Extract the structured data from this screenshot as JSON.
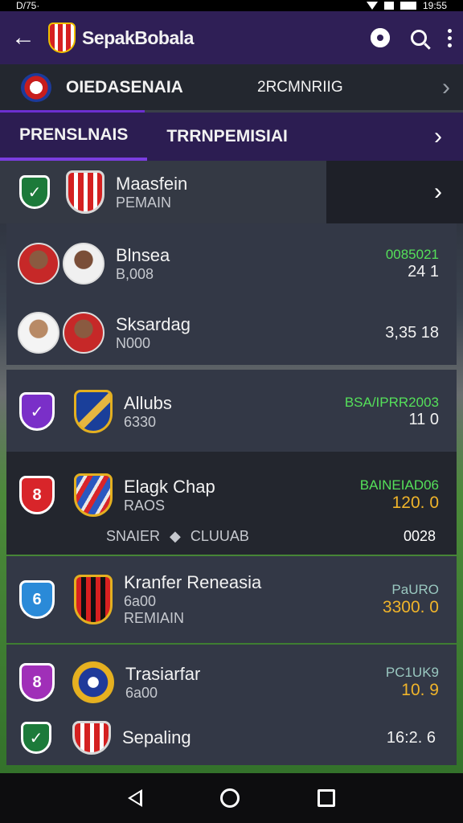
{
  "statusbar": {
    "left": "D/75·",
    "time": "19:55"
  },
  "appbar": {
    "title": "SepakBobala"
  },
  "league": {
    "label_left": "OIEDASENAIA",
    "label_right": "2RCMNRIIG"
  },
  "tabs": [
    {
      "label": "PRENSLNAIS"
    },
    {
      "label": "TRRNPEMISIAI"
    }
  ],
  "featured": {
    "name": "Maasfein",
    "sub": "PEMAIN"
  },
  "players_card": {
    "rows": [
      {
        "name": "Blnsea",
        "sub": "B,008",
        "stat_top": "0085021",
        "stat_main": "24  1"
      },
      {
        "name": "Sksardag",
        "sub": "N000",
        "stat_main": "3,35  18"
      }
    ]
  },
  "clubs": [
    {
      "name": "Allubs",
      "sub": "6330",
      "stat_top": "BSA/IPRR2003",
      "stat_main": "11  0"
    },
    {
      "name": "Elagk Chap",
      "sub": "RAOS",
      "stat_top": "BAINEIAD06",
      "stat_main": "120.  0",
      "footer_left": "SNAIER",
      "footer_mid": "CLUUAB",
      "footer_right": "0028"
    },
    {
      "name": "Kranfer Reneasia",
      "sub": "6a00",
      "sub2": "REMIAIN",
      "stat_top": "PaURO",
      "stat_main": "3300.  0"
    },
    {
      "name": "Trasiarfar",
      "sub": "6a00",
      "stat_top": "PC1UK9",
      "stat_main": "10.  9"
    },
    {
      "name": "Sepaling",
      "stat_main": "16:2.  6"
    }
  ],
  "icons": {
    "back": "arrow-left-icon",
    "settings": "gear-icon",
    "search": "search-icon",
    "more": "more-vert-icon"
  },
  "colors": {
    "appbar": "#2f1f56",
    "accent": "#7b3de0",
    "green_stat": "#55e05a",
    "gold_stat": "#f0b42a"
  }
}
